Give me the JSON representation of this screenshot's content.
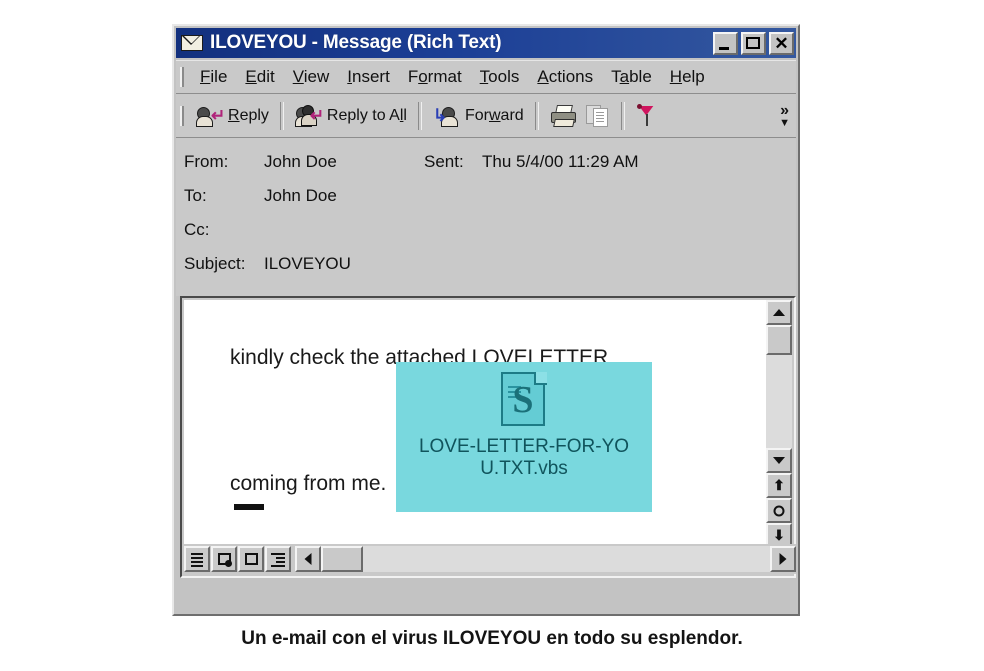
{
  "window": {
    "title": "ILOVEYOU - Message (Rich Text)",
    "icon": "envelope-icon",
    "caption_buttons": {
      "minimize": "_",
      "maximize": "□",
      "close": "✕"
    },
    "title_bar_color": "#1c3f96"
  },
  "menu": {
    "items": [
      {
        "label": "File",
        "accel": "F",
        "rest": "ile"
      },
      {
        "label": "Edit",
        "accel": "E",
        "rest": "dit"
      },
      {
        "label": "View",
        "accel": "V",
        "rest": "iew"
      },
      {
        "label": "Insert",
        "accel": "I",
        "rest": "nsert"
      },
      {
        "label": "Format",
        "accel": "o",
        "pre": "F",
        "rest": "rmat"
      },
      {
        "label": "Tools",
        "accel": "T",
        "rest": "ools"
      },
      {
        "label": "Actions",
        "accel": "A",
        "rest": "ctions"
      },
      {
        "label": "Table",
        "accel": "a",
        "pre": "T",
        "rest": "ble"
      },
      {
        "label": "Help",
        "accel": "H",
        "rest": "elp"
      }
    ]
  },
  "toolbar": {
    "reply_label": "Reply",
    "reply_pre": "",
    "reply_accel": "R",
    "reply_rest": "eply",
    "reply_all_label": "Reply to All",
    "reply_all_pre": "Reply to A",
    "reply_all_accel": "l",
    "reply_all_rest": "l",
    "forward_label": "Forward",
    "forward_pre": "For",
    "forward_accel": "w",
    "forward_rest": "ard",
    "print_icon": "printer-icon",
    "copy_icon": "copy-pages-icon",
    "flag_icon": "flag-icon",
    "overflow_label": "»",
    "overflow_triangle": "▼"
  },
  "header_fields": {
    "from_label": "From:",
    "from_value": "John Doe",
    "sent_label": "Sent:",
    "sent_value": "Thu 5/4/00 11:29 AM",
    "to_label": "To:",
    "to_value": "John Doe",
    "cc_label": "Cc:",
    "cc_value": "",
    "subject_label": "Subject:",
    "subject_value": "ILOVEYOU"
  },
  "message_body": {
    "line1": "kindly check the attached LOVELETTER",
    "line2": "coming from me.",
    "attachment": {
      "filename": "LOVE-LETTER-FOR-YOU.TXT.vbs",
      "icon": "vbscript-file-icon",
      "selection_color": "#79d8de",
      "label_color": "#10545c"
    }
  },
  "scrollbars": {
    "vertical": {
      "up_arrow": "▲",
      "down_arrow": "▼",
      "prev_page": "⬆",
      "browse_object": "○",
      "next_page": "⬇"
    },
    "horizontal": {
      "left_arrow": "◀",
      "right_arrow": "▶"
    }
  },
  "view_buttons": [
    {
      "name": "normal-view",
      "icon": "lines-icon"
    },
    {
      "name": "web-layout-view",
      "icon": "globe-page-icon"
    },
    {
      "name": "print-layout-view",
      "icon": "page-icon"
    },
    {
      "name": "outline-view",
      "icon": "outline-icon"
    }
  ],
  "figure": {
    "caption": "Un e-mail con el virus ILOVEYOU en todo su esplendor."
  }
}
